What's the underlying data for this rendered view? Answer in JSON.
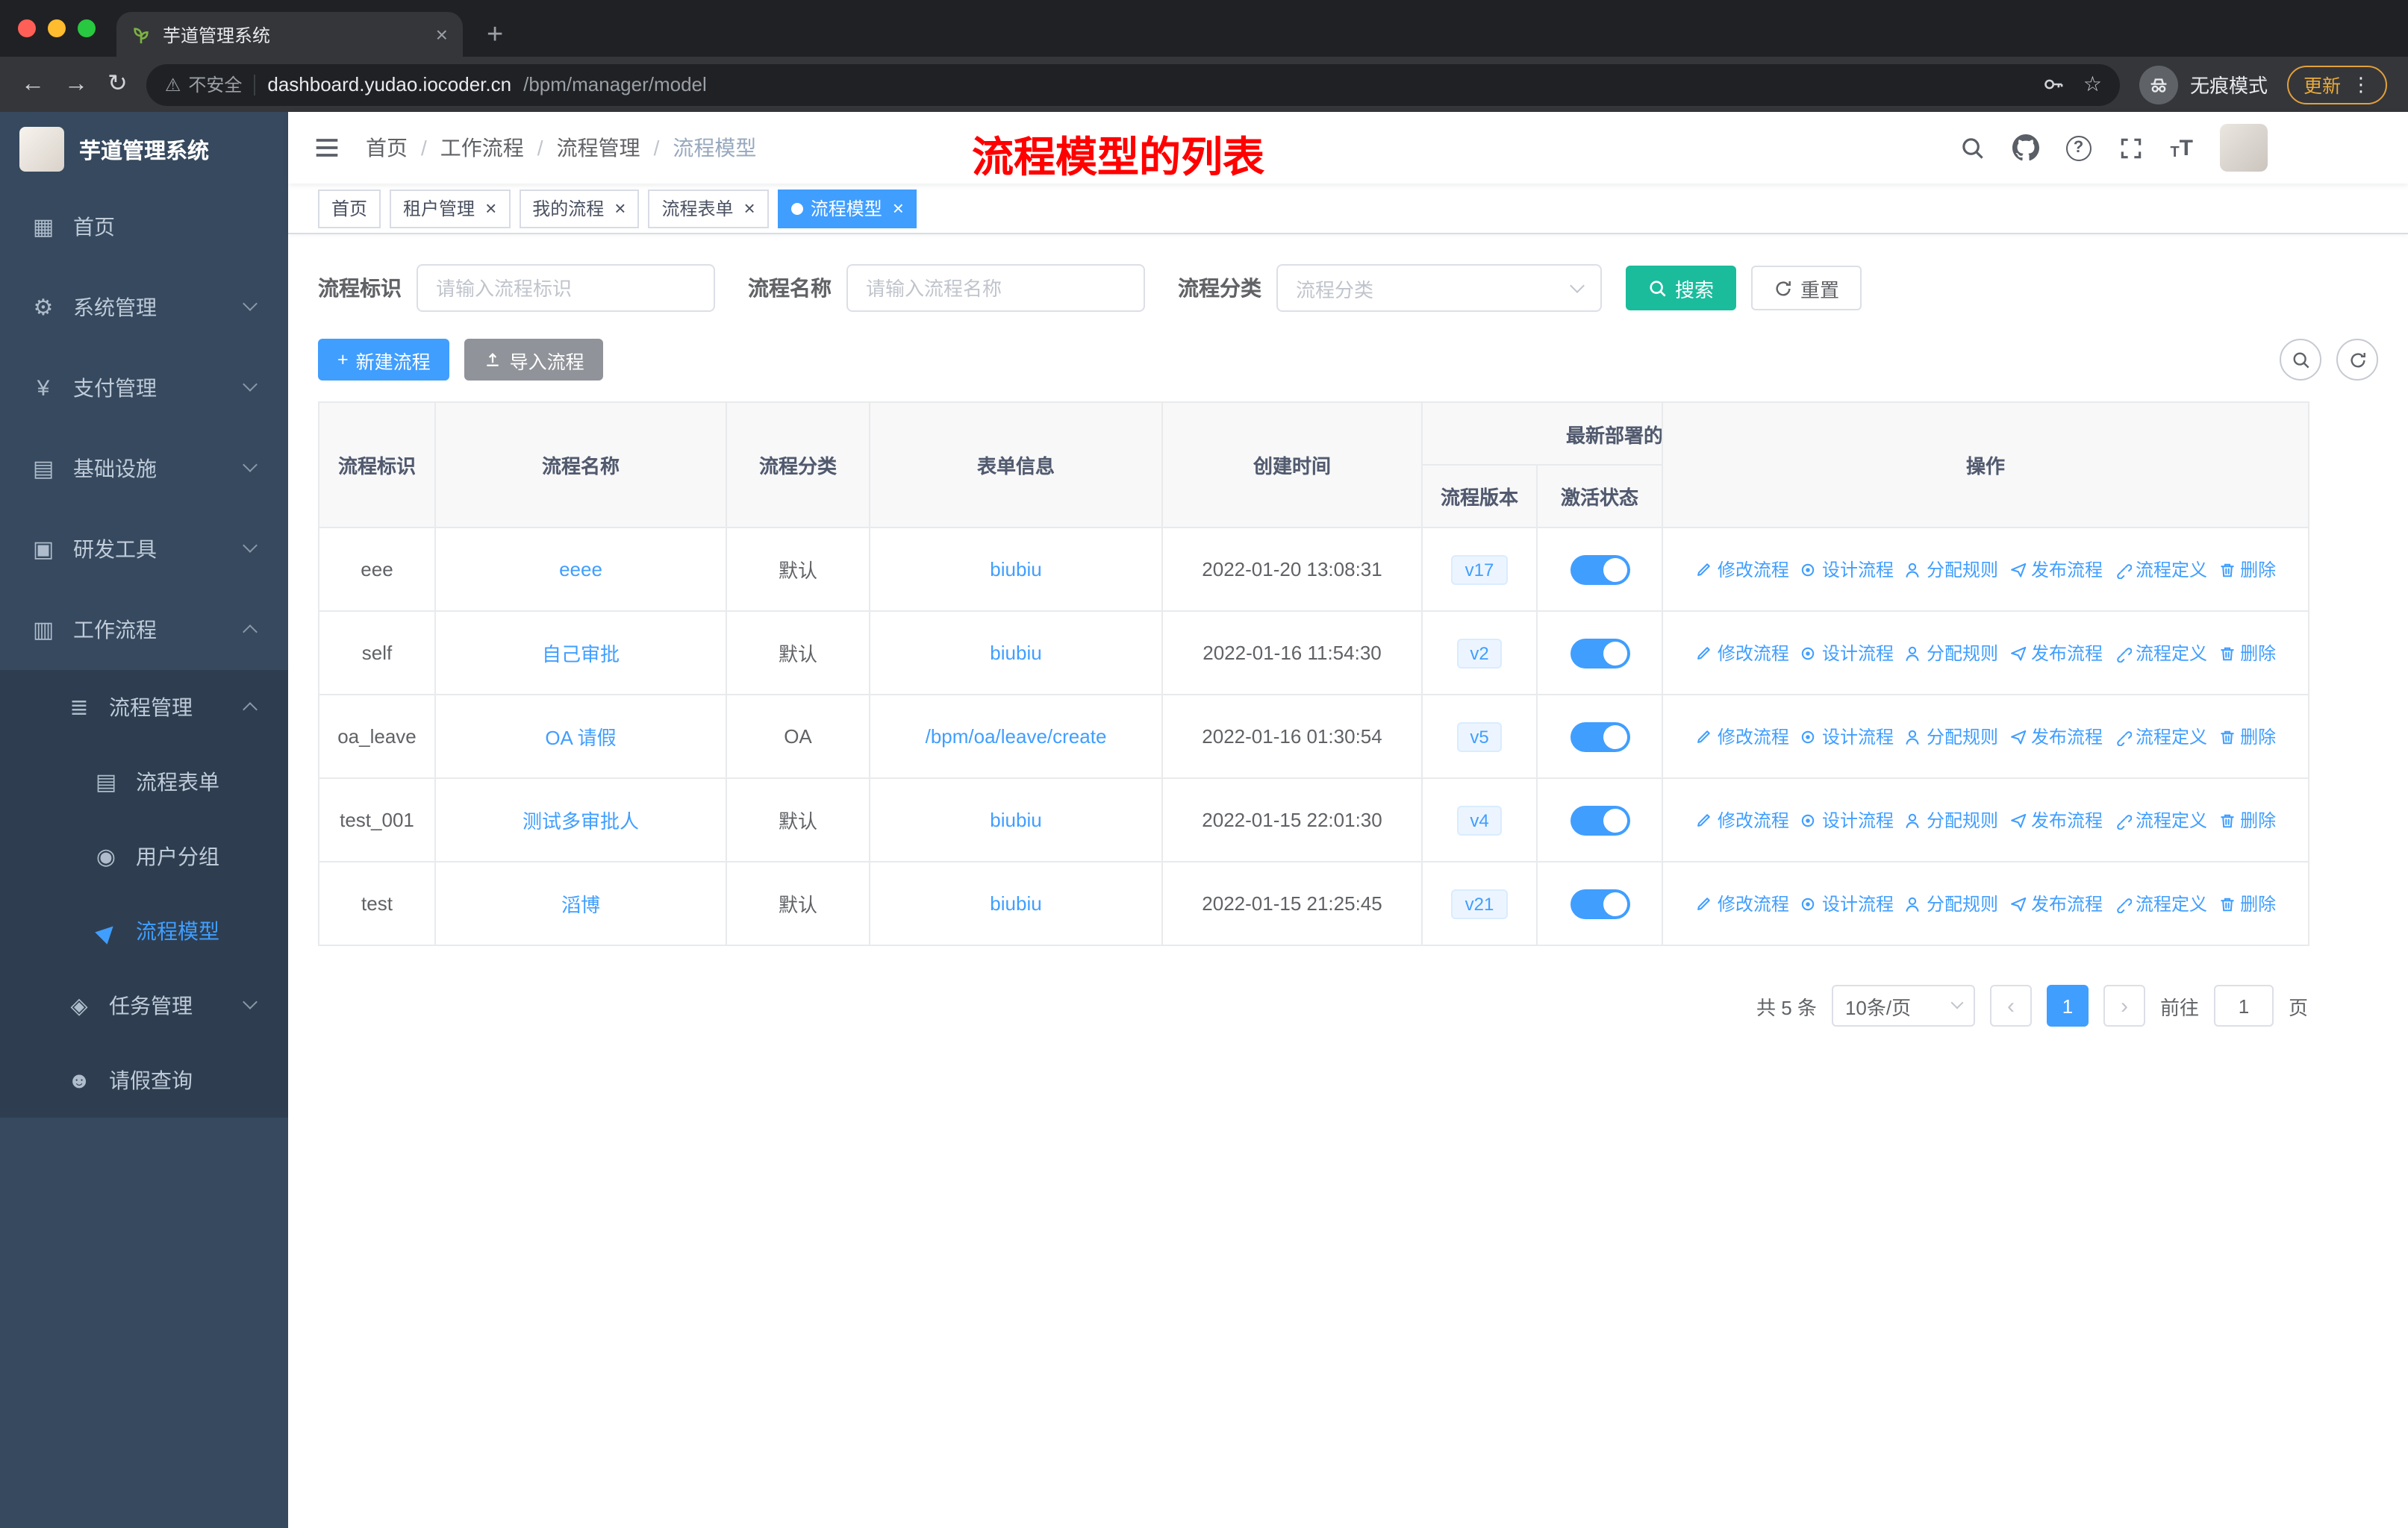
{
  "browser": {
    "tab_title": "芋道管理系统",
    "url_domain": "dashboard.yudao.iocoder.cn",
    "url_path": "/bpm/manager/model",
    "security_label": "不安全",
    "incognito_label": "无痕模式",
    "update_label": "更新"
  },
  "icons": {
    "warning": "⚠",
    "star": "☆",
    "kebab": "⋮",
    "new_tab": "+",
    "plus": "+",
    "back_arrow": "←",
    "forward_arrow": "→",
    "reload": "↻",
    "question": "?",
    "prev": "‹",
    "next": "›",
    "close": "×",
    "font_letter": "T",
    "sidebar": {
      "home": "▦",
      "system": "⚙",
      "payment": "¥",
      "infrastructure": "▤",
      "devtools": "▣",
      "workflow": "▥",
      "process_manage": "≣",
      "process_form": "▤",
      "user_group": "◉",
      "process_model": "▶",
      "task_manage": "◈",
      "leave_query": "☻"
    }
  },
  "sidebar": {
    "title": "芋道管理系统",
    "items": [
      {
        "label": "首页"
      },
      {
        "label": "系统管理"
      },
      {
        "label": "支付管理"
      },
      {
        "label": "基础设施"
      },
      {
        "label": "研发工具"
      },
      {
        "label": "工作流程"
      },
      {
        "label": "流程管理"
      },
      {
        "label": "流程表单"
      },
      {
        "label": "用户分组"
      },
      {
        "label": "流程模型"
      },
      {
        "label": "任务管理"
      },
      {
        "label": "请假查询"
      }
    ]
  },
  "header": {
    "breadcrumb": [
      "首页",
      "工作流程",
      "流程管理",
      "流程模型"
    ],
    "annotation": "流程模型的列表"
  },
  "tags": [
    {
      "label": "首页"
    },
    {
      "label": "租户管理"
    },
    {
      "label": "我的流程"
    },
    {
      "label": "流程表单"
    },
    {
      "label": "流程模型"
    }
  ],
  "filters": {
    "key_label": "流程标识",
    "key_placeholder": "请输入流程标识",
    "name_label": "流程名称",
    "name_placeholder": "请输入流程名称",
    "category_label": "流程分类",
    "category_placeholder": "流程分类",
    "search": "搜索",
    "reset": "重置"
  },
  "toolbar": {
    "create": "新建流程",
    "import": "导入流程"
  },
  "table": {
    "col_key": "流程标识",
    "col_name": "流程名称",
    "col_category": "流程分类",
    "col_form": "表单信息",
    "col_created": "创建时间",
    "col_group": "最新部署的",
    "col_version": "流程版本",
    "col_status": "激活状态",
    "col_actions": "操作",
    "actions": [
      "修改流程",
      "设计流程",
      "分配规则",
      "发布流程",
      "流程定义",
      "删除"
    ],
    "rows": [
      {
        "key": "eee",
        "name": "eeee",
        "category": "默认",
        "form": "biubiu",
        "created": "2022-01-20 13:08:31",
        "version": "v17"
      },
      {
        "key": "self",
        "name": "自己审批",
        "category": "默认",
        "form": "biubiu",
        "created": "2022-01-16 11:54:30",
        "version": "v2"
      },
      {
        "key": "oa_leave",
        "name": "OA 请假",
        "category": "OA",
        "form": "/bpm/oa/leave/create",
        "created": "2022-01-16 01:30:54",
        "version": "v5"
      },
      {
        "key": "test_001",
        "name": "测试多审批人",
        "category": "默认",
        "form": "biubiu",
        "created": "2022-01-15 22:01:30",
        "version": "v4"
      },
      {
        "key": "test",
        "name": "滔博",
        "category": "默认",
        "form": "biubiu",
        "created": "2022-01-15 21:25:45",
        "version": "v21"
      }
    ]
  },
  "pagination": {
    "total": "共 5 条",
    "page_size": "10条/页",
    "page": "1",
    "goto": "前往",
    "goto_value": "1",
    "unit": "页"
  },
  "colors": {
    "accent": "#409EFF",
    "search_button": "#1ABC9C",
    "annotation": "#FF0000",
    "sidebar_bg": "#36495E"
  }
}
